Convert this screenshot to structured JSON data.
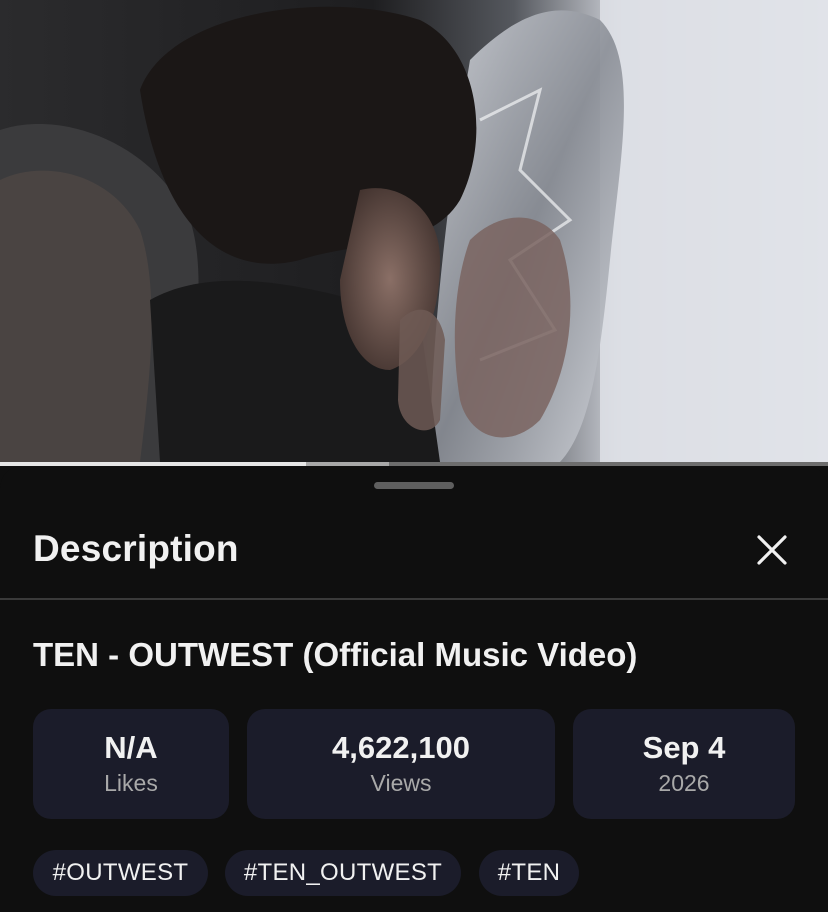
{
  "video": {
    "progress": 0.37,
    "buffered": 0.47
  },
  "sheet": {
    "title": "Description",
    "close_icon": "close-icon"
  },
  "video_title": "TEN - OUTWEST (Official Music Video)",
  "stats": {
    "likes": {
      "value": "N/A",
      "label": "Likes"
    },
    "views": {
      "value": "4,622,100",
      "label": "Views"
    },
    "date": {
      "value": "Sep 4",
      "label": "2026"
    }
  },
  "hashtags": [
    "#OUTWEST",
    "#TEN_OUTWEST",
    "#TEN"
  ],
  "colors": {
    "background": "#0f0f0f",
    "card": "#1b1c2a",
    "text": "#f1f1f1",
    "muted_text": "#a9a9a9"
  }
}
